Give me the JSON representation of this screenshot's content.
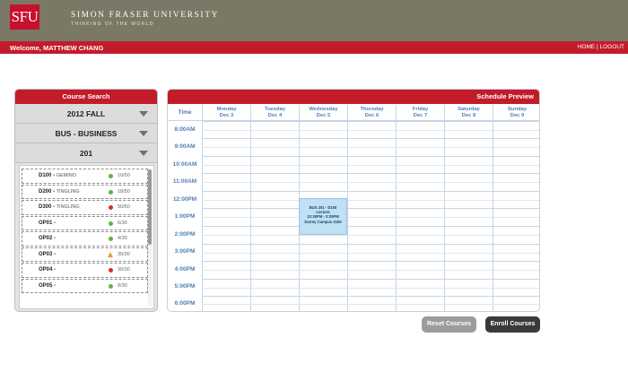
{
  "header": {
    "logo_text": "SFU",
    "university_name": "SIMON FRASER UNIVERSITY",
    "tagline": "THINKING OF THE WORLD",
    "welcome": "Welcome, MATTHEW CHANG",
    "nav": {
      "home": "HOME",
      "separator": "|",
      "logout": "LOGOUT"
    }
  },
  "course_search": {
    "title": "Course Search",
    "term": "2012 FALL",
    "department": "BUS - BUSINESS",
    "course_number": "201",
    "sections": [
      {
        "code": "D100 -",
        "instructor": "GEMINO",
        "status": "open",
        "status_color": "#5fb33a",
        "count": "10/50"
      },
      {
        "code": "D200 -",
        "instructor": "TINGLING",
        "status": "open",
        "status_color": "#5fb33a",
        "count": "18/50"
      },
      {
        "code": "D300 -",
        "instructor": "TINGLING",
        "status": "full",
        "status_color": "#d62c2c",
        "count": "50/50"
      },
      {
        "code": "OP01 -",
        "instructor": "",
        "status": "open",
        "status_color": "#5fb33a",
        "count": "6/30"
      },
      {
        "code": "OP02 -",
        "instructor": "",
        "status": "open",
        "status_color": "#5fb33a",
        "count": "4/30"
      },
      {
        "code": "OP03 -",
        "instructor": "",
        "status": "warning",
        "status_color": "#e3a21a",
        "count": "30/30"
      },
      {
        "code": "OP04 -",
        "instructor": "",
        "status": "full",
        "status_color": "#d62c2c",
        "count": "30/30"
      },
      {
        "code": "OP05 -",
        "instructor": "",
        "status": "open",
        "status_color": "#5fb33a",
        "count": "8/30"
      }
    ]
  },
  "schedule": {
    "title": "Schedule Preview",
    "time_header": "Time",
    "days": [
      {
        "day": "Monday",
        "date": "Dec 3"
      },
      {
        "day": "Tuesday",
        "date": "Dec 4"
      },
      {
        "day": "Wednesday",
        "date": "Dec 5"
      },
      {
        "day": "Thursday",
        "date": "Dec 6"
      },
      {
        "day": "Friday",
        "date": "Dec 7"
      },
      {
        "day": "Saturday",
        "date": "Dec 8"
      },
      {
        "day": "Sunday",
        "date": "Dec 9"
      }
    ],
    "times": [
      "8:00AM",
      "9:00AM",
      "10:00AM",
      "11:00AM",
      "12:00PM",
      "1:00PM",
      "2:00PM",
      "3:00PM",
      "4:00PM",
      "5:00PM",
      "6:00PM"
    ],
    "event": {
      "line1": "BUS 201 - D100",
      "line2": "Lecture",
      "line3": "12:30PM - 2:20PM",
      "line4": "Surrey Campus 3150"
    }
  },
  "buttons": {
    "reset": "Reset Courses",
    "enroll": "Enroll Courses"
  },
  "colors": {
    "header": "#7b7865",
    "accent": "#c21c2b",
    "link_blue": "#4d7fb5",
    "event_bg": "#bfe0f5"
  }
}
